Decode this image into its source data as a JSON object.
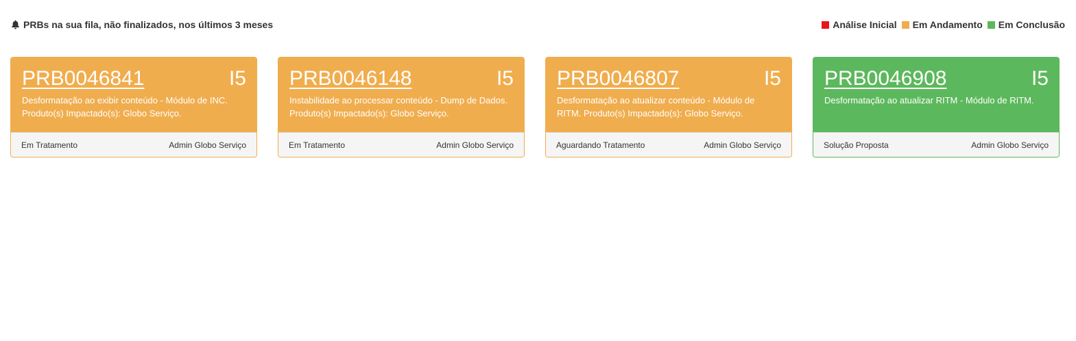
{
  "header": {
    "title": "PRBs na sua fila, não finalizados, nos últimos 3 meses",
    "icon": "bell-icon"
  },
  "legend": [
    {
      "label": "Análise Inicial",
      "color": "#e8151c"
    },
    {
      "label": "Em Andamento",
      "color": "#f0ad4e"
    },
    {
      "label": "Em Conclusão",
      "color": "#5cb85c"
    }
  ],
  "cards": [
    {
      "number": "PRB0046841",
      "priority": "I5",
      "description": "Desformatação ao exibir conteúdo - Módulo de INC. Produto(s) Impactado(s): Globo Serviço.",
      "status": "Em Tratamento",
      "assignee": "Admin Globo Serviço",
      "color": "#f0ad4e"
    },
    {
      "number": "PRB0046148",
      "priority": "I5",
      "description": "Instabilidade ao processar conteúdo - Dump de Dados. Produto(s) Impactado(s): Globo Serviço.",
      "status": "Em Tratamento",
      "assignee": "Admin Globo Serviço",
      "color": "#f0ad4e"
    },
    {
      "number": "PRB0046807",
      "priority": "I5",
      "description": "Desformatação ao atualizar conteúdo - Módulo de RITM. Produto(s) Impactado(s): Globo Serviço.",
      "status": "Aguardando Tratamento",
      "assignee": "Admin Globo Serviço",
      "color": "#f0ad4e"
    },
    {
      "number": "PRB0046908",
      "priority": "I5",
      "description": "Desformatação ao atualizar RITM - Módulo de RITM.",
      "status": "Solução Proposta",
      "assignee": "Admin Globo Serviço",
      "color": "#5cb85c"
    }
  ]
}
